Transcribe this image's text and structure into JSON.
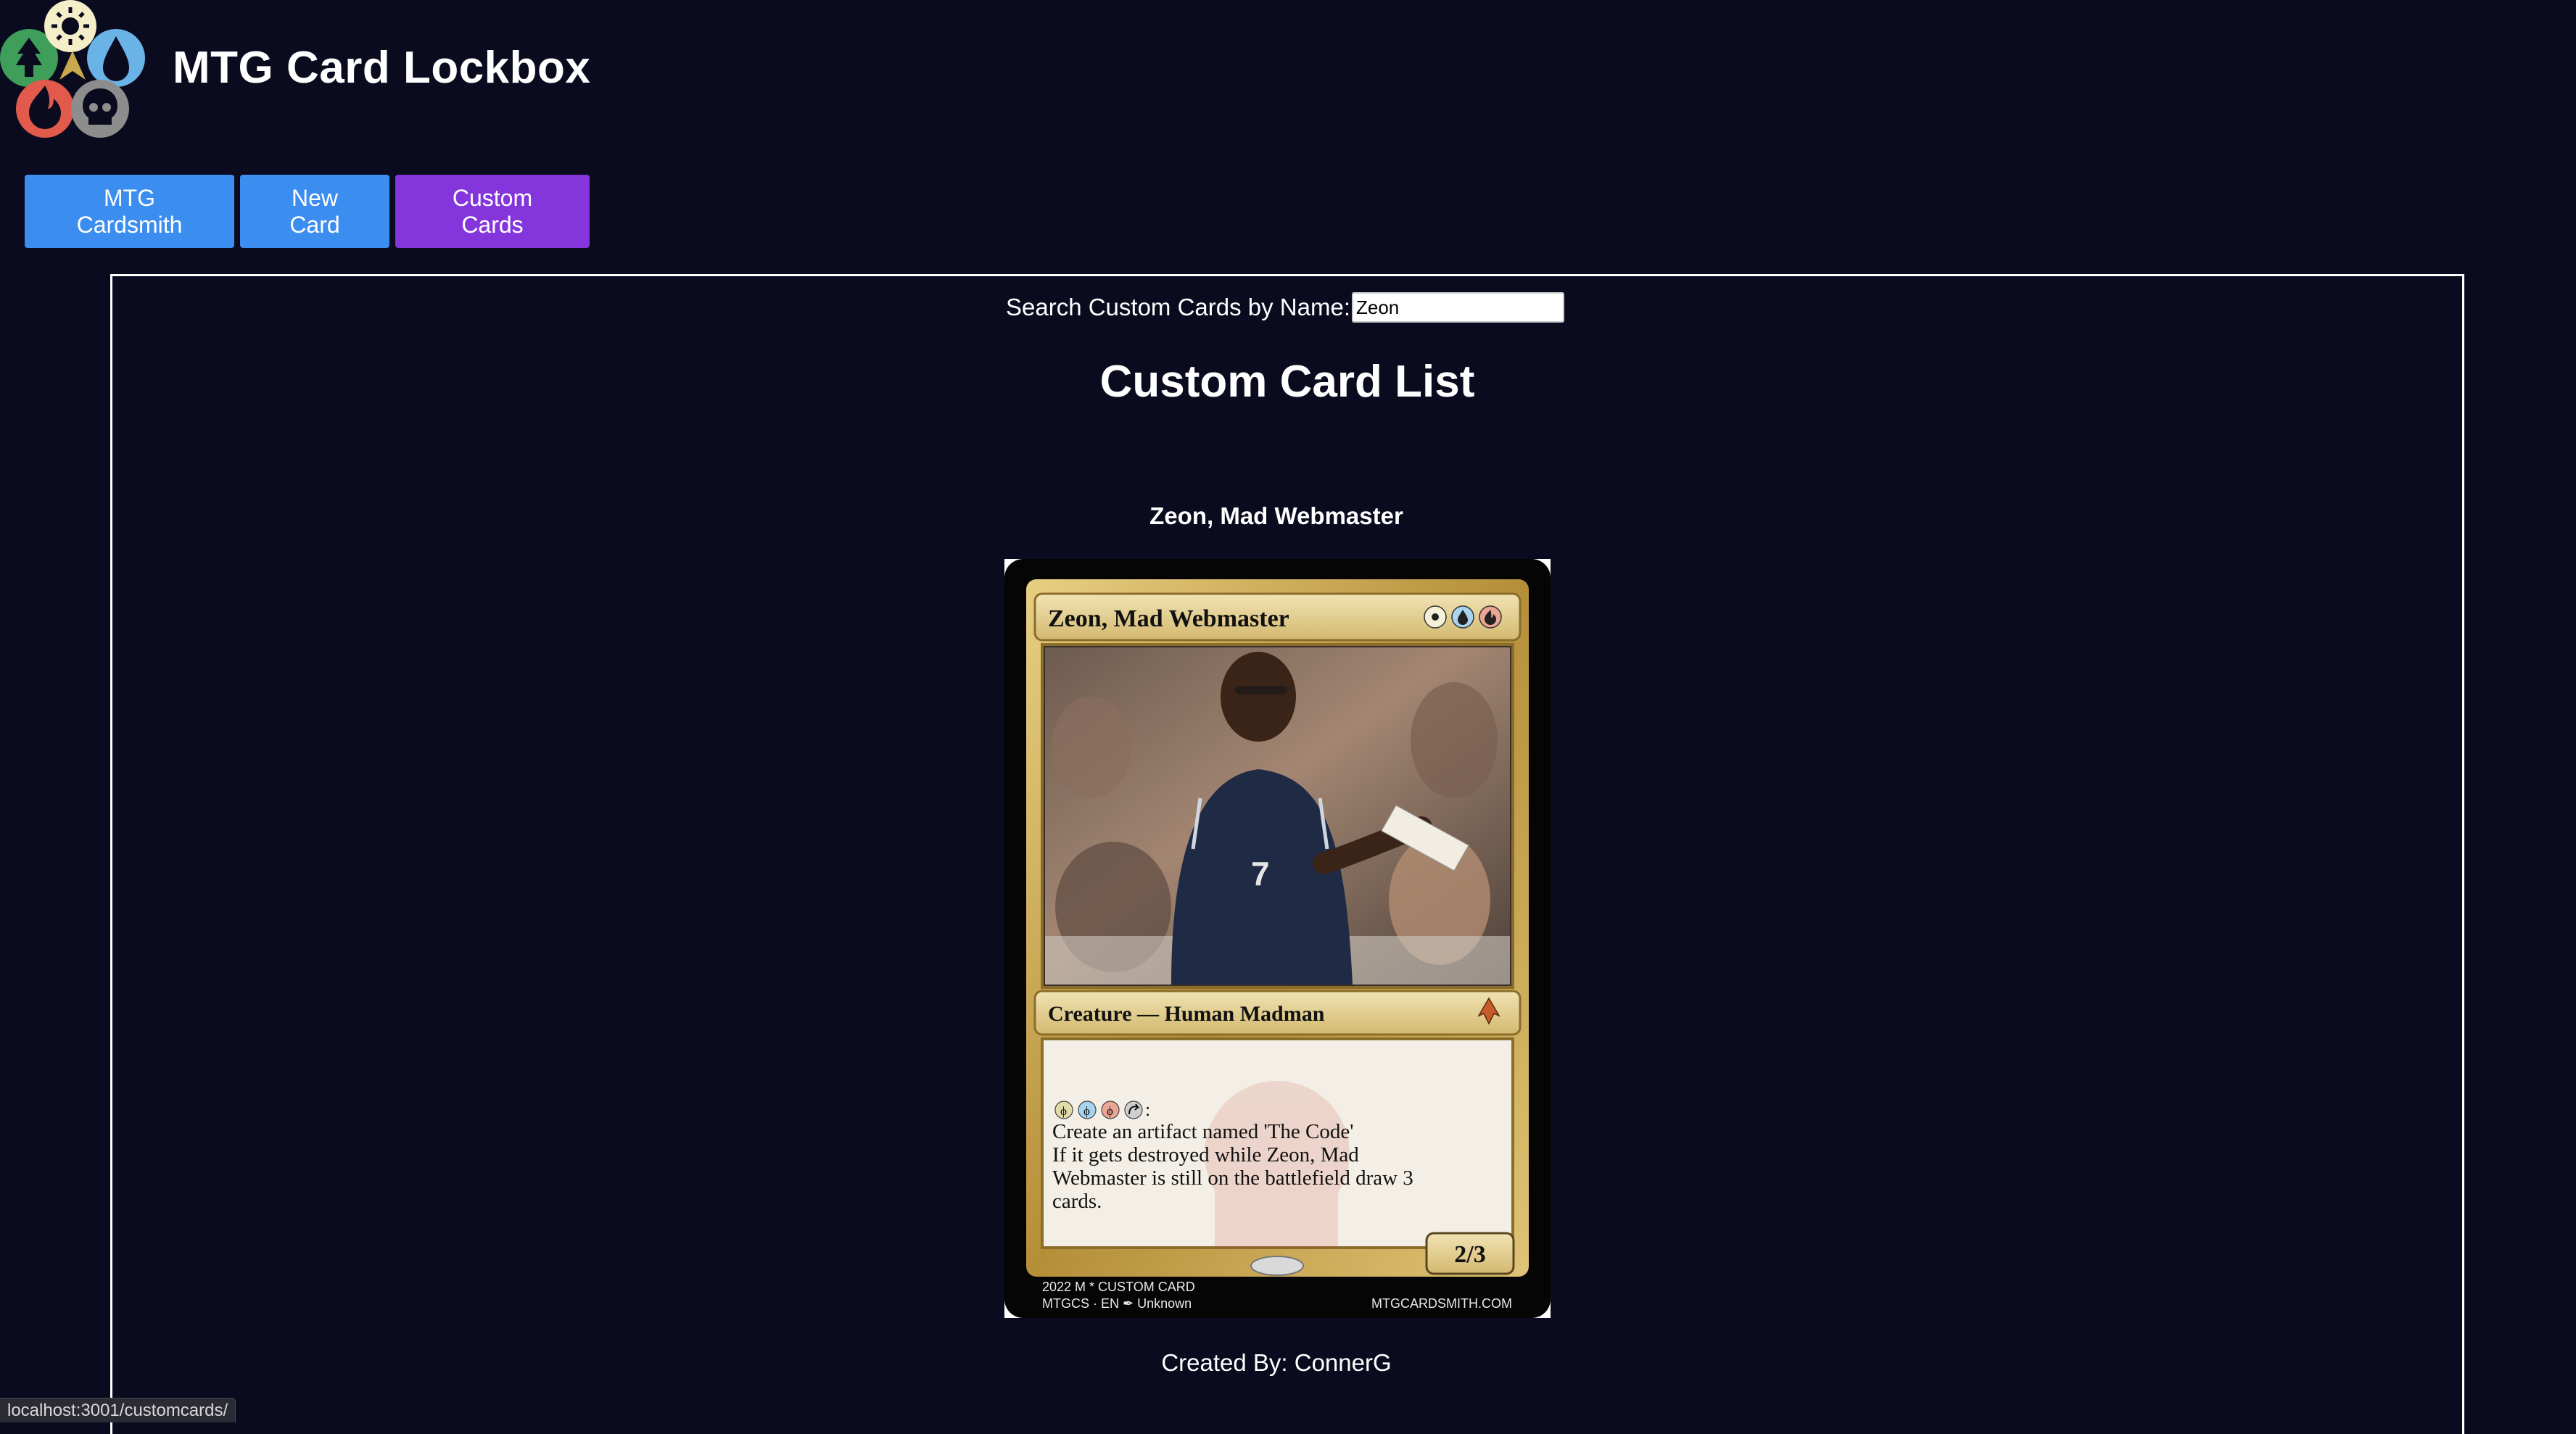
{
  "app": {
    "title": "MTG Card Lockbox",
    "logo_icon": "mtg-five-color-mana-logo-icon"
  },
  "nav": {
    "items": [
      {
        "label": "MTG Cardsmith",
        "color": "#3b8df0",
        "active": false
      },
      {
        "label": "New Card",
        "color": "#3b8df0",
        "active": false
      },
      {
        "label": "Custom Cards",
        "color": "#8436dc",
        "active": true
      }
    ]
  },
  "search": {
    "label": "Search Custom Cards by Name:",
    "value": "Zeon"
  },
  "list": {
    "title": "Custom Card List",
    "cards": [
      {
        "name": "Zeon, Mad Webmaster",
        "created_by": "Created By: ConnerG",
        "image": {
          "card_title": "Zeon, Mad Webmaster",
          "mana_cost_icons": [
            "white-mana-icon",
            "blue-mana-icon",
            "red-mana-icon"
          ],
          "type_line": "Creature — Human Madman",
          "set_symbol_icon": "set-symbol-icon",
          "ability_cost_icons": [
            "phi-symbol-icon",
            "phi-symbol-icon",
            "phi-symbol-icon",
            "tap-symbol-icon"
          ],
          "ability_cost_suffix": ":",
          "rules_lines": [
            "Create an artifact named 'The Code'",
            "If it gets destroyed while Zeon, Mad",
            "Webmaster is still on the battlefield draw 3",
            "cards."
          ],
          "power_toughness": "2/3",
          "footer_left_1": "2022 M * CUSTOM CARD",
          "footer_left_2": "MTGCS · EN ✒ Unknown",
          "footer_right": "MTGCARDSMITH.COM"
        }
      }
    ]
  },
  "colors": {
    "background": "#0b0b1f",
    "nav_blue": "#3b8df0",
    "nav_purple": "#8436dc",
    "card_gold": "#c9a84e"
  },
  "status_bar": {
    "url": "localhost:3001/customcards/"
  }
}
